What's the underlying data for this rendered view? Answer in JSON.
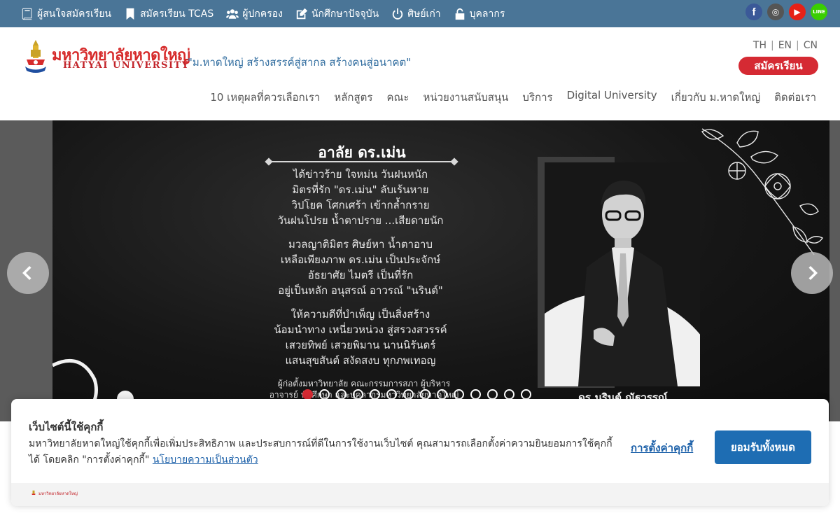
{
  "topbar": {
    "links": [
      {
        "label": "ผู้สนใจสมัครเรียน",
        "icon": "book-icon"
      },
      {
        "label": "สมัครเรียน TCAS",
        "icon": "bookmark-icon"
      },
      {
        "label": "ผู้ปกครอง",
        "icon": "users-icon"
      },
      {
        "label": "นักศึกษาปัจจุบัน",
        "icon": "edit-icon"
      },
      {
        "label": "ศิษย์เก่า",
        "icon": "power-icon"
      },
      {
        "label": "บุคลากร",
        "icon": "unlock-icon"
      }
    ],
    "socials": [
      {
        "name": "facebook-icon",
        "glyph": "f",
        "color": "#3b5998"
      },
      {
        "name": "instagram-icon",
        "glyph": "◎",
        "color": "#555555"
      },
      {
        "name": "youtube-icon",
        "glyph": "▶",
        "color": "#e62117"
      },
      {
        "name": "line-icon",
        "glyph": "LINE",
        "color": "#3ace01"
      }
    ]
  },
  "header": {
    "logo_th": "มหาวิทยาลัยหาดใหญ่",
    "logo_en": "HATYAI UNIVERSITY",
    "slogan": "\"ม.หาดใหญ่ สร้างสรรค์สู่สากล สร้างคนสู่อนาคต\"",
    "languages": [
      "TH",
      "EN",
      "CN"
    ],
    "enroll_label": "สมัครเรียน",
    "nav": [
      "10 เหตุผลที่ควรเลือกเรา",
      "หลักสูตร",
      "คณะ",
      "หน่วยงานสนับสนุน",
      "บริการ",
      "Digital University",
      "เกี่ยวกับ ม.หาดใหญ่",
      "ติดต่อเรา"
    ]
  },
  "hero": {
    "poem_title": "อาลัย ดร.เม่น",
    "stanzas": [
      [
        "ได้ข่าวร้าย ใจหม่น วันฝนหนัก",
        "มิตรที่รัก \"ดร.เม่น\" ลับเร้นหาย",
        "วิปโยค โศกเศร้า เข้ากล้ำกราย",
        "วันฝนโปรย น้ำตาปราย ...เสียดายนัก"
      ],
      [
        "มวลญาติมิตร ศิษย์หา น้ำตาอาบ",
        "เหลือเพียงภาพ ดร.เม่น เป็นประจักษ์",
        "อัธยาศัย ไมตรี เป็นที่รัก",
        "อยู่เป็นหลัก อนุสรณ์ อาวรณ์ \"นรินต์\""
      ],
      [
        "ให้ความดีที่บำเพ็ญ เป็นสิ่งสร้าง",
        "น้อมนำทาง เหนี่ยวหน่วง สู่สรวงสวรรค์",
        "เสวยทิพย์ เสวยพิมาน นานนิรันดร์",
        "แสนสุขสันต์ สงัดสงบ ทุกภพเทอญ"
      ]
    ],
    "footer_lines": [
      "ผู้ก่อตั้งมหาวิทยาลัย คณะกรรมการสภา ผู้บริหาร",
      "อาจารย์ นักศึกษา และบุคลากรมหาวิทยาลัยหาดใหญ่"
    ],
    "photo_caption": "ดร.นรินต์ ณัฐวรรณ์",
    "dot_count": 14,
    "active_dot": 1
  },
  "cookie": {
    "title": "เว็บไซต์นี้ใช้คุกกี้",
    "text": "มหาวิทยาลัยหาดใหญ่ใช้คุกกี้เพื่อเพิ่มประสิทธิภาพ และประสบการณ์ที่ดีในการใช้งานเว็บไซต์ คุณสามารถเลือกตั้งค่าความยินยอมการใช้คุกกี้ได้ โดยคลิก \"การตั้งค่าคุกกี้\"",
    "policy_link": "นโยบายความเป็นส่วนตัว",
    "settings_label": "การตั้งค่าคุกกี้",
    "accept_label": "ยอมรับทั้งหมด",
    "footer_logo": "มหาวิทยาลัยหาดใหญ่"
  },
  "colors": {
    "topbar": "#4a7597",
    "brand_red": "#d52a33",
    "link_blue": "#1a5fa8",
    "accept_blue": "#1e6db3"
  }
}
